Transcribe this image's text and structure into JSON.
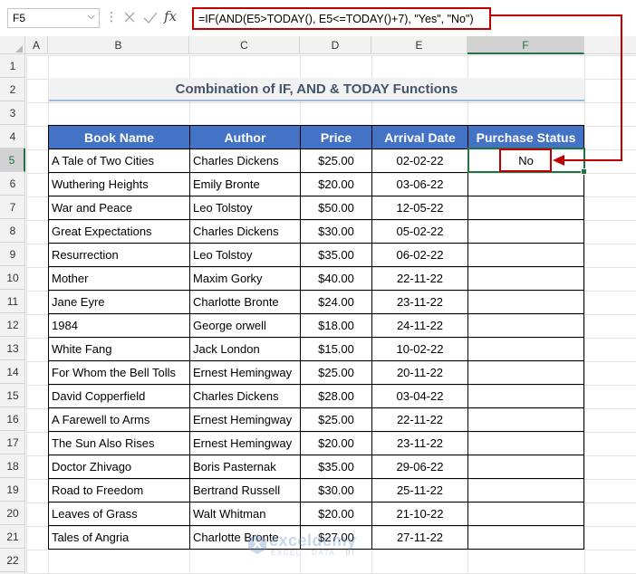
{
  "formula_bar": {
    "name_box": "F5",
    "fx_label": "fx",
    "formula": "=IF(AND(E5>TODAY(), E5<=TODAY()+7), \"Yes\", \"No\")"
  },
  "columns": [
    "A",
    "B",
    "C",
    "D",
    "E",
    "F"
  ],
  "rows": [
    "1",
    "2",
    "3",
    "4",
    "5",
    "6",
    "7",
    "8",
    "9",
    "10",
    "11",
    "12",
    "13",
    "14",
    "15",
    "16",
    "17",
    "18",
    "19",
    "20",
    "21",
    "22"
  ],
  "title": "Combination of IF, AND & TODAY Functions",
  "table": {
    "headers": [
      "Book Name",
      "Author",
      "Price",
      "Arrival Date",
      "Purchase Status"
    ],
    "rows": [
      [
        "A Tale of Two Cities",
        "Charles Dickens",
        "$25.00",
        "02-02-22",
        "No"
      ],
      [
        "Wuthering Heights",
        "Emily Bronte",
        "$20.00",
        "03-06-22",
        ""
      ],
      [
        "War and Peace",
        "Leo Tolstoy",
        "$50.00",
        "12-05-22",
        ""
      ],
      [
        "Great Expectations",
        "Charles Dickens",
        "$30.00",
        "05-02-22",
        ""
      ],
      [
        "Resurrection",
        "Leo Tolstoy",
        "$35.00",
        "06-02-22",
        ""
      ],
      [
        "Mother",
        "Maxim Gorky",
        "$40.00",
        "22-11-22",
        ""
      ],
      [
        "Jane Eyre",
        "Charlotte Bronte",
        "$24.00",
        "23-11-22",
        ""
      ],
      [
        "1984",
        "George orwell",
        "$18.00",
        "24-11-22",
        ""
      ],
      [
        "White Fang",
        "Jack London",
        "$15.00",
        "10-02-22",
        ""
      ],
      [
        "For Whom the Bell Tolls",
        "Ernest Hemingway",
        "$25.00",
        "20-11-22",
        ""
      ],
      [
        "David Copperfield",
        "Charles Dickens",
        "$28.00",
        "03-04-22",
        ""
      ],
      [
        "A Farewell to Arms",
        "Ernest Hemingway",
        "$25.00",
        "22-11-22",
        ""
      ],
      [
        "The Sun Also Rises",
        "Ernest Hemingway",
        "$20.00",
        "23-11-22",
        ""
      ],
      [
        "Doctor Zhivago",
        "Boris Pasternak",
        "$35.00",
        "29-06-22",
        ""
      ],
      [
        "Road to Freedom",
        "Bertrand Russell",
        "$30.00",
        "25-11-22",
        ""
      ],
      [
        "Leaves of Grass",
        "Walt Whitman",
        "$20.00",
        "21-10-22",
        ""
      ],
      [
        "Tales of Angria",
        "Charlotte Bronte",
        "$27.00",
        "27-11-22",
        ""
      ]
    ]
  },
  "selected": {
    "column": "F",
    "row": "5"
  },
  "watermark": {
    "name": "exceldemy",
    "tagline": "EXCEL · DATA · BI"
  },
  "colors": {
    "header_fill": "#4472c4",
    "highlight_red": "#c00000",
    "selection_green": "#217346",
    "title_text": "#44546a"
  }
}
